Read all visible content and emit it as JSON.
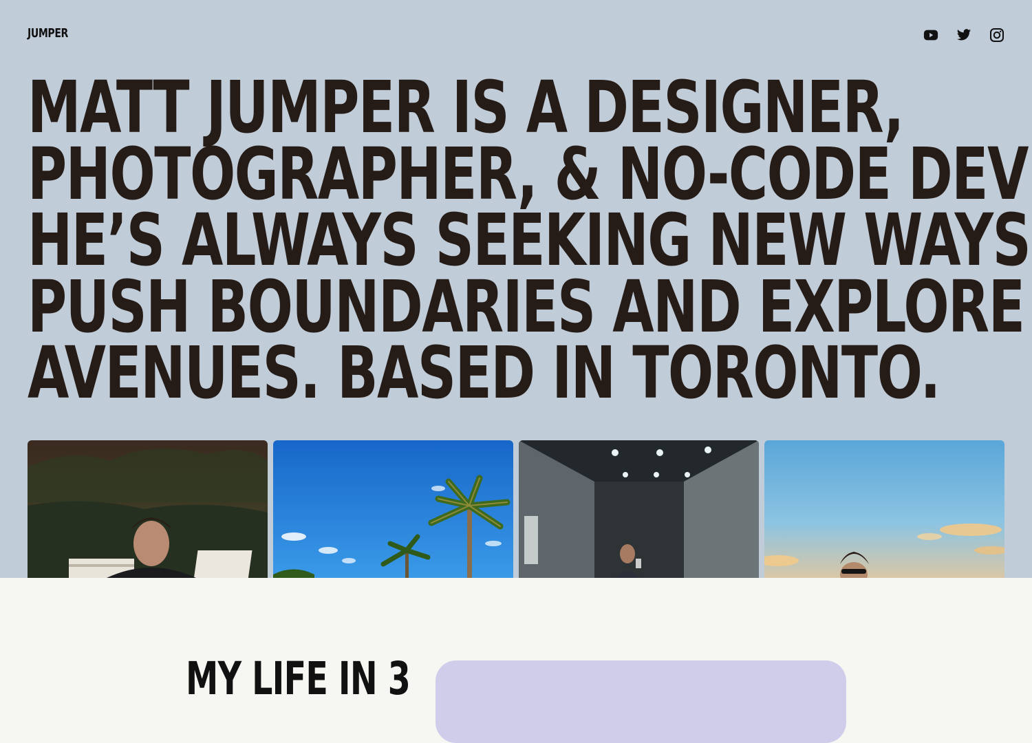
{
  "header": {
    "logo": "JUMPER",
    "social": [
      {
        "icon": "youtube-icon"
      },
      {
        "icon": "twitter-icon"
      },
      {
        "icon": "instagram-icon"
      }
    ]
  },
  "hero": {
    "headline_lines": [
      "MATT JUMPER IS A DESIGNER,",
      "PHOTOGRAPHER, & NO-CODE DEVELOPER.",
      "HE’S ALWAYS SEEKING NEW WAYS TO",
      "PUSH BOUNDARIES AND EXPLORE NEW",
      "AVENUES. BASED IN TORONTO."
    ],
    "photos": [
      {
        "subject": "portrait-by-pool-chairs"
      },
      {
        "subject": "palm-trees-blue-sky"
      },
      {
        "subject": "elevator-mirror-selfie"
      },
      {
        "subject": "sunset-sky-portrait"
      }
    ]
  },
  "section": {
    "title": "MY LIFE IN 3"
  },
  "colors": {
    "hero_bg": "#c1ccd9",
    "text": "#261c17",
    "page_bg": "#f6f6f2",
    "card": "#d0cdea"
  }
}
